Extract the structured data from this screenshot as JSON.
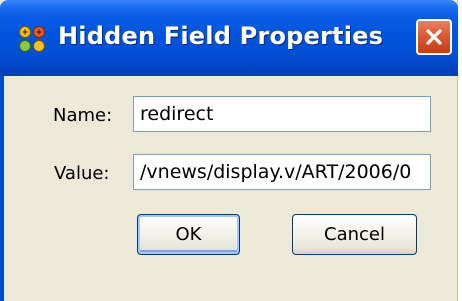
{
  "window": {
    "title": "Hidden Field Properties",
    "app_icon": "app-dots-icon",
    "close_icon": "close-icon",
    "titlebar_color": "#0354dd",
    "close_color": "#db5a36"
  },
  "form": {
    "name_label": "Name:",
    "name_value": "redirect",
    "value_label": "Value:",
    "value_value": "/vnews/display.v/ART/2006/0"
  },
  "buttons": {
    "ok_label": "OK",
    "cancel_label": "Cancel"
  }
}
